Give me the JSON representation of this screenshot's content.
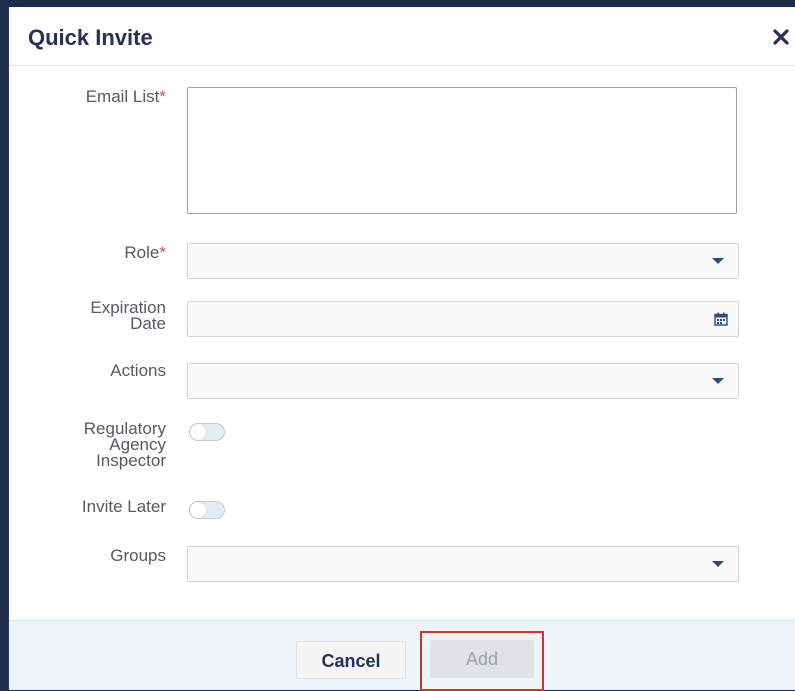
{
  "dialog": {
    "title": "Quick Invite",
    "close_icon": "close-icon"
  },
  "form": {
    "email_list": {
      "label": "Email List",
      "required_mark": "*",
      "value": ""
    },
    "role": {
      "label": "Role",
      "required_mark": "*",
      "value": "",
      "icon": "chevron-down-icon"
    },
    "expiration_date": {
      "label_line1": "Expiration",
      "label_line2": "Date",
      "value": "",
      "icon": "calendar-icon"
    },
    "actions": {
      "label": "Actions",
      "value": "",
      "icon": "chevron-down-icon"
    },
    "regulatory_agency_inspector": {
      "label_line1": "Regulatory",
      "label_line2": "Agency",
      "label_line3": "Inspector",
      "on": false
    },
    "invite_later": {
      "label": "Invite Later",
      "on": false
    },
    "groups": {
      "label": "Groups",
      "value": "",
      "icon": "chevron-down-icon"
    }
  },
  "footer": {
    "cancel_label": "Cancel",
    "add_label": "Add"
  },
  "colors": {
    "title": "#27305a",
    "required": "#e2474b",
    "caret": "#2c4a82",
    "highlight": "#d9302b"
  }
}
